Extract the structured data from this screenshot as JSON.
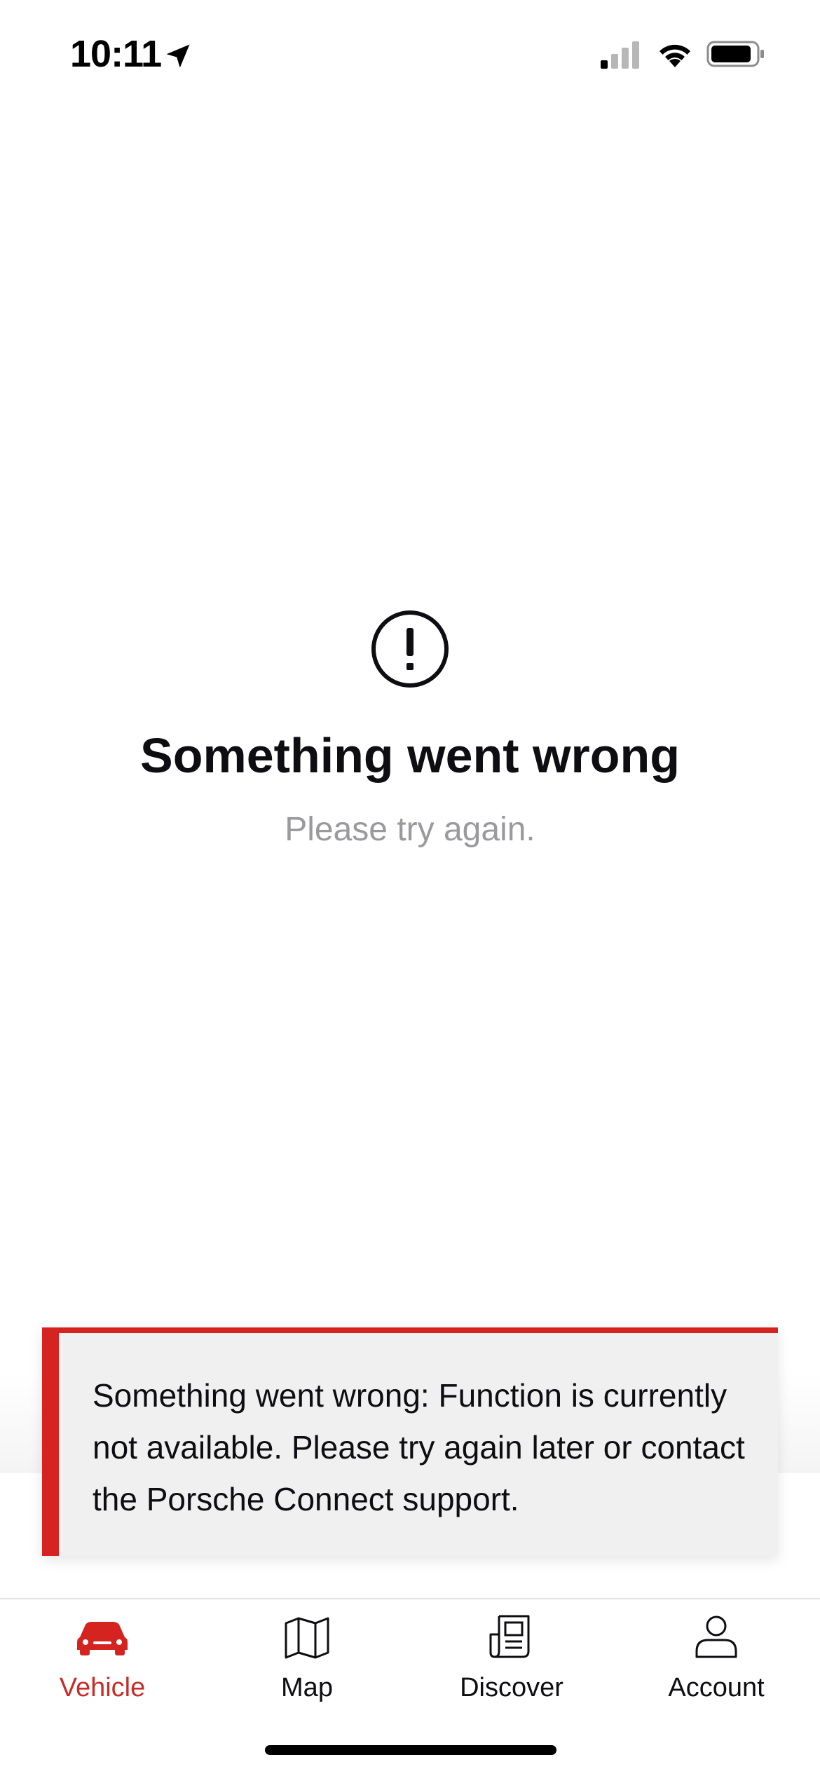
{
  "status_bar": {
    "time": "10:11",
    "icons": [
      "location-arrow-icon",
      "cellular-signal-icon",
      "wifi-icon",
      "battery-icon"
    ]
  },
  "error_state": {
    "icon": "alert-circle-icon",
    "title": "Something went wrong",
    "subtitle": "Please try again."
  },
  "toast": {
    "message": "Something went wrong: Function is currently not available. Please try again later or contact the Porsche Connect support.",
    "accent_color": "#d5241f"
  },
  "tab_bar": {
    "active_color": "#c62d28",
    "tabs": [
      {
        "label": "Vehicle",
        "icon": "car-icon",
        "active": true
      },
      {
        "label": "Map",
        "icon": "map-icon",
        "active": false
      },
      {
        "label": "Discover",
        "icon": "news-icon",
        "active": false
      },
      {
        "label": "Account",
        "icon": "user-icon",
        "active": false
      }
    ]
  }
}
